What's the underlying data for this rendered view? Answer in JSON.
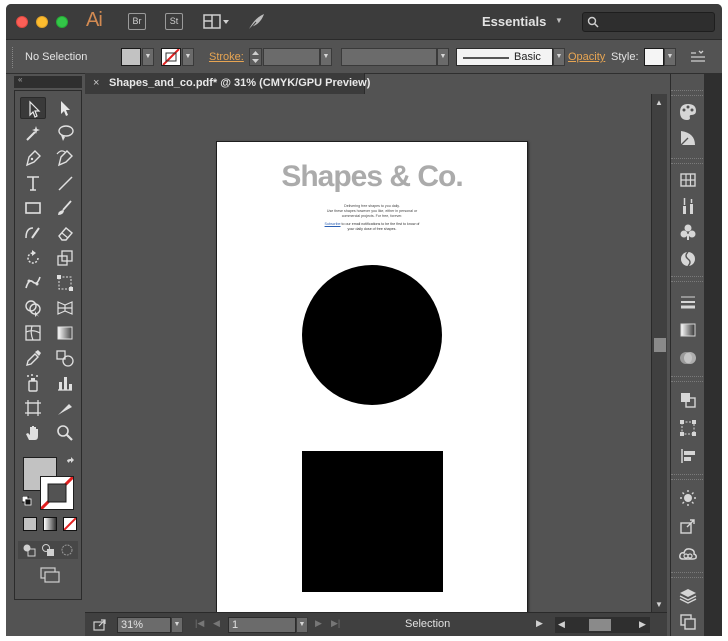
{
  "titlebar": {
    "app_logo": "Ai",
    "bridge_label": "Br",
    "stock_label": "St",
    "workspace_label": "Essentials",
    "search_placeholder": ""
  },
  "controlbar": {
    "selection_label": "No Selection",
    "stroke_label": "Stroke:",
    "brush_label": "Basic",
    "opacity_label": "Opacity",
    "style_label": "Style:"
  },
  "document": {
    "tab_title": "Shapes_and_co.pdf* @ 31% (CMYK/GPU Preview)",
    "close_glyph": "×",
    "artboard": {
      "heading": "Shapes & Co.",
      "intro_line1": "Delivering free shapes to you daily.",
      "intro_line2": "Use these shapes however you like, either in personal or",
      "intro_line3": "commercial projects. For free, forever.",
      "subscribe_link": "Subscribe",
      "subscribe_rest": "to our email notifications to be the first to know of",
      "subscribe_line2": "your daily dose of free shapes."
    }
  },
  "statusbar": {
    "zoom": "31%",
    "page": "1",
    "tool_status": "Selection"
  },
  "colors": {
    "accent_orange": "#e7a553",
    "ai_logo": "#d28a52",
    "fill_swatch": "#c2c2c2",
    "artboard_heading": "#ababab"
  }
}
